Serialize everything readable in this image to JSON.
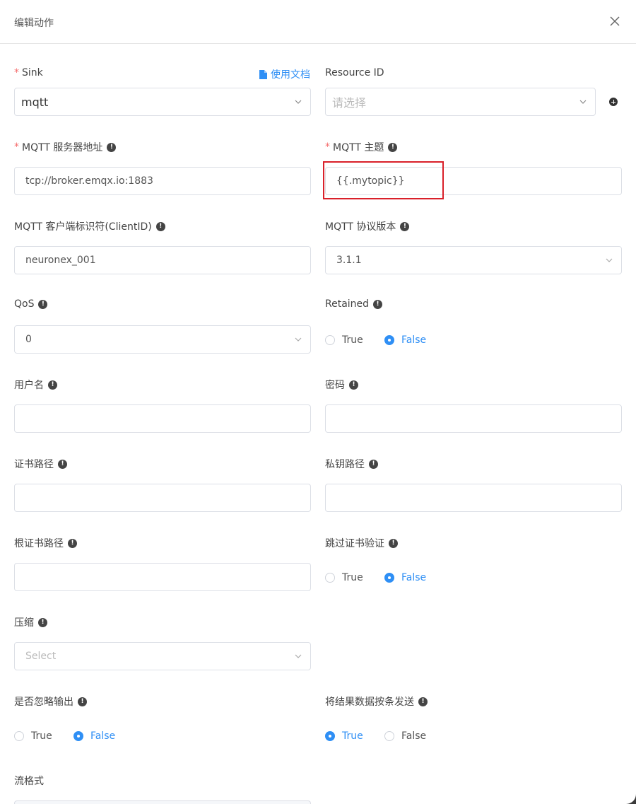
{
  "dialog": {
    "title": "编辑动作"
  },
  "sink": {
    "label": "Sink",
    "value": "mqtt",
    "doc_link": "使用文档"
  },
  "resource": {
    "label": "Resource ID",
    "placeholder": "请选择"
  },
  "server": {
    "label": "MQTT 服务器地址",
    "value": "tcp://broker.emqx.io:1883"
  },
  "topic": {
    "label": "MQTT 主题",
    "value": "{{.mytopic}}"
  },
  "client_id": {
    "label": "MQTT 客户端标识符(ClientID)",
    "value": "neuronex_001"
  },
  "protocol": {
    "label": "MQTT 协议版本",
    "value": "3.1.1"
  },
  "qos": {
    "label": "QoS",
    "value": "0"
  },
  "retained": {
    "label": "Retained",
    "true_label": "True",
    "false_label": "False",
    "selected": "False"
  },
  "username": {
    "label": "用户名",
    "value": ""
  },
  "password": {
    "label": "密码",
    "value": ""
  },
  "cert_path": {
    "label": "证书路径",
    "value": ""
  },
  "key_path": {
    "label": "私钥路径",
    "value": ""
  },
  "root_cert": {
    "label": "根证书路径",
    "value": ""
  },
  "skip_verify": {
    "label": "跳过证书验证",
    "true_label": "True",
    "false_label": "False",
    "selected": "False"
  },
  "compression": {
    "label": "压缩",
    "placeholder": "Select"
  },
  "omit_output": {
    "label": "是否忽略输出",
    "true_label": "True",
    "false_label": "False",
    "selected": "False"
  },
  "send_single": {
    "label": "将结果数据按条发送",
    "true_label": "True",
    "false_label": "False",
    "selected": "True"
  },
  "stream_format": {
    "label": "流格式"
  },
  "help_icon": "!",
  "colors": {
    "accent": "#2f8ff5",
    "required": "#f56c6c",
    "highlight": "#d9202a"
  }
}
